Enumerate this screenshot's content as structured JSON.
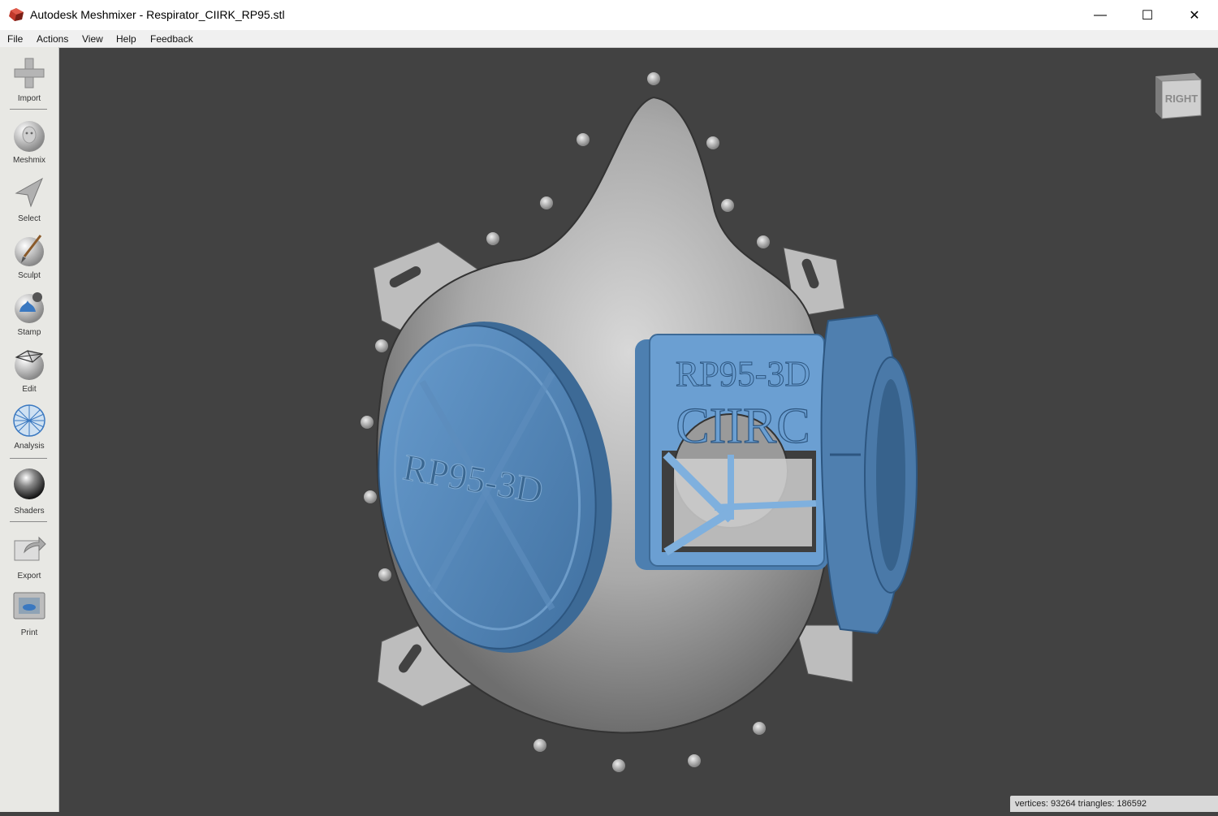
{
  "window": {
    "title": "Autodesk Meshmixer - Respirator_CIIRK_RP95.stl",
    "controls": {
      "minimize": "—",
      "maximize": "☐",
      "close": "✕"
    }
  },
  "menu": [
    "File",
    "Actions",
    "View",
    "Help",
    "Feedback"
  ],
  "tools": [
    {
      "label": "Import",
      "icon": "plus-icon"
    },
    {
      "label": "Meshmix",
      "icon": "face-sphere-icon"
    },
    {
      "label": "Select",
      "icon": "arrow-cursor-icon"
    },
    {
      "label": "Sculpt",
      "icon": "brush-sphere-icon"
    },
    {
      "label": "Stamp",
      "icon": "stamp-sphere-icon"
    },
    {
      "label": "Edit",
      "icon": "edit-sphere-icon"
    },
    {
      "label": "Analysis",
      "icon": "mesh-sphere-icon"
    },
    {
      "label": "Shaders",
      "icon": "shaded-sphere-icon"
    },
    {
      "label": "Export",
      "icon": "export-icon"
    },
    {
      "label": "Print",
      "icon": "printer-icon"
    }
  ],
  "viewport": {
    "viewcube_label": "RIGHT",
    "model_text_filter": "RP95-3D",
    "model_text_valve_1": "RP95-3D",
    "model_text_valve_2": "CIIRC",
    "status": "vertices: 93264 triangles: 186592",
    "colors": {
      "background": "#424242",
      "mesh": "#b9b9b9",
      "selection": "#5b8fc4"
    }
  }
}
